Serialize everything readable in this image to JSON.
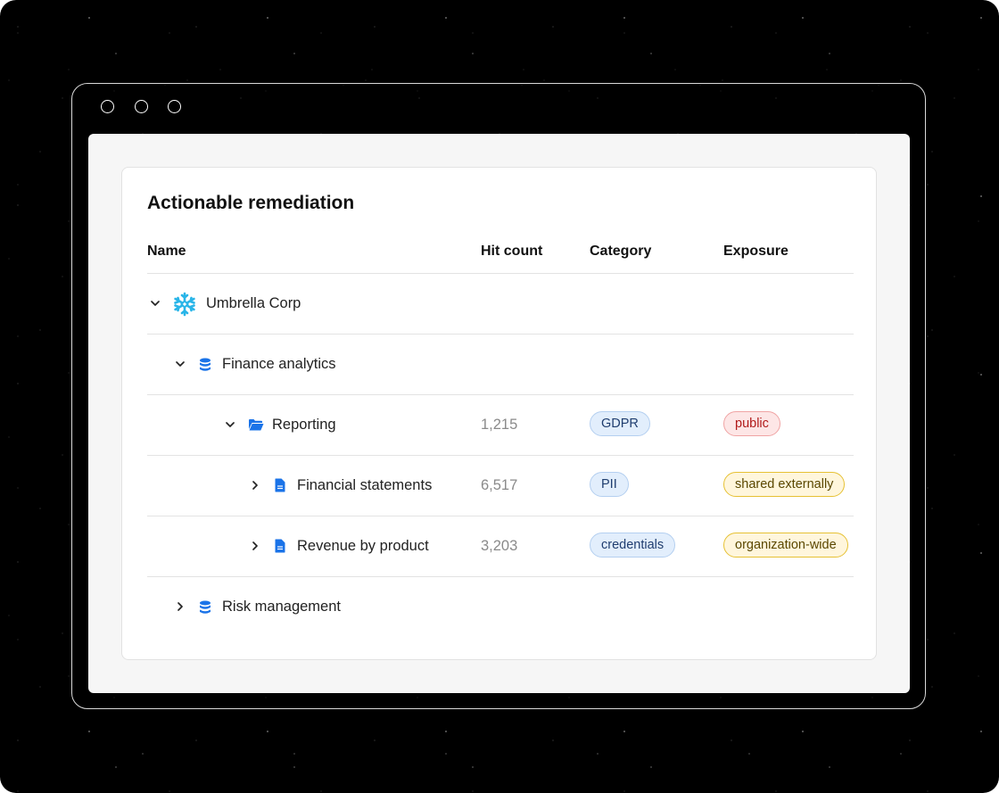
{
  "card": {
    "title": "Actionable remediation",
    "columns": {
      "name": "Name",
      "hit_count": "Hit count",
      "category": "Category",
      "exposure": "Exposure"
    }
  },
  "rows": [
    {
      "name": "Umbrella Corp",
      "icon": "snowflake-icon",
      "expanded": true,
      "hit": "",
      "category": "",
      "exposure": ""
    },
    {
      "name": "Finance analytics",
      "icon": "database-icon",
      "expanded": true,
      "hit": "",
      "category": "",
      "exposure": ""
    },
    {
      "name": "Reporting",
      "icon": "folder-icon",
      "expanded": true,
      "hit": "1,215",
      "category": "GDPR",
      "exposure": "public"
    },
    {
      "name": "Financial statements",
      "icon": "document-icon",
      "expanded": false,
      "hit": "6,517",
      "category": "PII",
      "exposure": "shared externally"
    },
    {
      "name": "Revenue by product",
      "icon": "document-icon",
      "expanded": false,
      "hit": "3,203",
      "category": "credentials",
      "exposure": "organization-wide"
    },
    {
      "name": "Risk management",
      "icon": "database-icon",
      "expanded": false,
      "hit": "",
      "category": "",
      "exposure": ""
    }
  ],
  "colors": {
    "accent": "#1a73e8",
    "snowflake": "#29b5e8"
  }
}
